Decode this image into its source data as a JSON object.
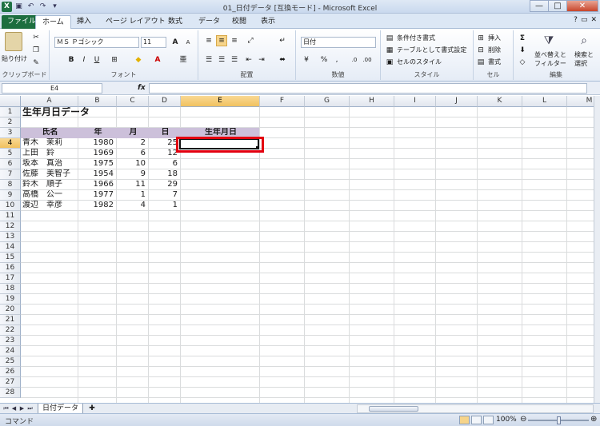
{
  "window": {
    "title": "01_日付データ [互換モード] - Microsoft Excel",
    "app_icon": "X",
    "controls": {
      "minimize": "—",
      "maximize": "□",
      "close": "✕"
    }
  },
  "ribbon_tabs": [
    "ファイル",
    "ホーム",
    "挿入",
    "ページ レイアウト",
    "数式",
    "データ",
    "校閲",
    "表示"
  ],
  "ribbon": {
    "clipboard": {
      "label": "クリップボード",
      "paste": "貼り付け"
    },
    "font": {
      "label": "フォント",
      "font_name": "ＭＳ Ｐゴシック",
      "font_size": "11",
      "bold": "B",
      "italic": "I",
      "underline": "U",
      "grow": "A",
      "shrink": "A"
    },
    "alignment": {
      "label": "配置"
    },
    "number": {
      "label": "数値",
      "format": "日付",
      "percent": "%",
      "comma": ","
    },
    "styles": {
      "label": "スタイル",
      "conditional": "条件付き書式",
      "table": "テーブルとして書式設定",
      "cell_style": "セルのスタイル"
    },
    "cells": {
      "label": "セル",
      "insert": "挿入",
      "delete": "削除",
      "format": "書式"
    },
    "editing": {
      "label": "編集",
      "sort": "並べ替えと",
      "filter": "フィルター",
      "find": "検索と",
      "select": "選択"
    }
  },
  "formula_bar": {
    "name_box": "E4",
    "fx": "fx",
    "value": ""
  },
  "columns": [
    "A",
    "B",
    "C",
    "D",
    "E",
    "F",
    "G",
    "H",
    "I",
    "J",
    "K",
    "L",
    "M"
  ],
  "selected_cell": "E4",
  "sheet": {
    "title": "生年月日データ",
    "headers": [
      "氏名",
      "年",
      "月",
      "日",
      "生年月日"
    ],
    "rows": [
      [
        "青木　茉莉",
        "1980",
        "2",
        "25"
      ],
      [
        "上田　鈴",
        "1969",
        "6",
        "12"
      ],
      [
        "坂本　真治",
        "1975",
        "10",
        "6"
      ],
      [
        "佐藤　美智子",
        "1954",
        "9",
        "18"
      ],
      [
        "鈴木　順子",
        "1966",
        "11",
        "29"
      ],
      [
        "高橋　公一",
        "1977",
        "1",
        "7"
      ],
      [
        "渡辺　幸彦",
        "1982",
        "4",
        "1"
      ]
    ]
  },
  "sheet_tab": "日付データ",
  "status": {
    "mode": "コマンド",
    "zoom": "100%"
  }
}
